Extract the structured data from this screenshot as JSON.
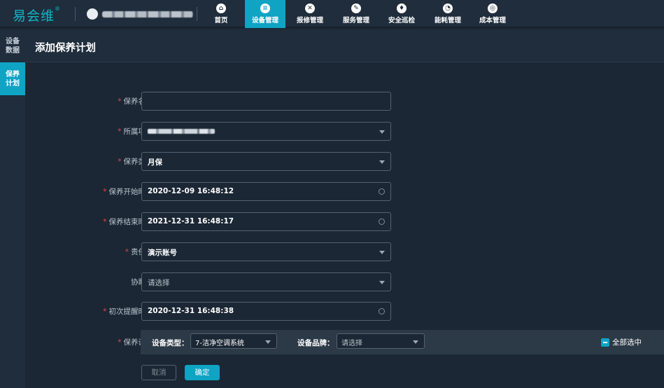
{
  "app": {
    "logo": "易会维",
    "logo_mark": "®"
  },
  "nav": [
    {
      "label": "首页",
      "icon": "home-icon",
      "glyph": "⌂"
    },
    {
      "label": "设备管理",
      "icon": "device-icon",
      "glyph": "≡",
      "active": true
    },
    {
      "label": "报修管理",
      "icon": "repair-icon",
      "glyph": "✕"
    },
    {
      "label": "服务管理",
      "icon": "service-icon",
      "glyph": "✎"
    },
    {
      "label": "安全巡检",
      "icon": "inspection-icon",
      "glyph": "♦"
    },
    {
      "label": "能耗管理",
      "icon": "energy-icon",
      "glyph": "◔"
    },
    {
      "label": "成本管理",
      "icon": "cost-icon",
      "glyph": "◎"
    }
  ],
  "sidebar": [
    {
      "label": "设备数据"
    },
    {
      "label": "保养计划",
      "active": true
    }
  ],
  "page": {
    "title": "添加保养计划"
  },
  "form": {
    "name": {
      "label": "保养名称：",
      "value": ""
    },
    "project": {
      "label": "所属项目："
    },
    "type": {
      "label": "保养类型：",
      "value": "月保"
    },
    "start": {
      "label": "保养开始时间：",
      "value": "2020-12-09 16:48:12"
    },
    "end": {
      "label": "保养结束时间：",
      "value": "2021-12-31 16:48:17"
    },
    "owner": {
      "label": "责任人：",
      "value": "演示账号"
    },
    "helper": {
      "label": "协助人：",
      "placeholder": "请选择"
    },
    "remind": {
      "label": "初次提醒时间：",
      "value": "2020-12-31 16:48:38"
    },
    "equipment": {
      "label": "保养设备：",
      "type_label": "设备类型：",
      "type_value": "7-洁净空调系统",
      "brand_label": "设备品牌：",
      "brand_placeholder": "请选择",
      "select_all": "全部选中"
    }
  },
  "actions": {
    "cancel": "取消",
    "confirm": "确定"
  },
  "colors": {
    "accent": "#0fa3c4",
    "required": "#e04848",
    "background": "#1b2734"
  }
}
